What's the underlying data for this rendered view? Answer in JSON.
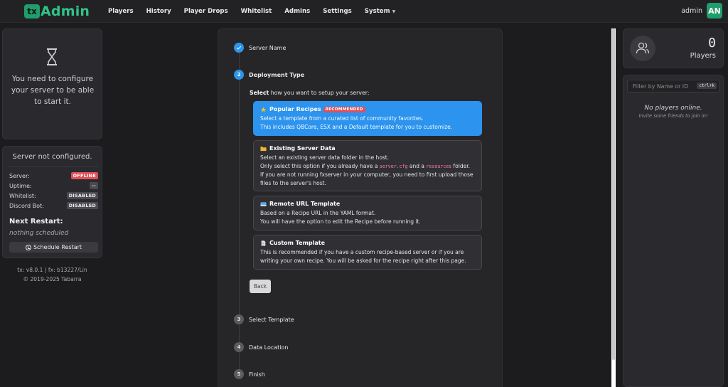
{
  "header": {
    "logo_mark": "tx",
    "logo_text": "Admin",
    "nav": [
      "Players",
      "History",
      "Player Drops",
      "Whitelist",
      "Admins",
      "Settings",
      "System"
    ],
    "username": "admin",
    "avatar_initials": "AN"
  },
  "notice": {
    "icon": "hourglass-icon",
    "text": "You need to configure your server to be able to start it."
  },
  "status": {
    "title": "Server not configured.",
    "rows": [
      {
        "label": "Server:",
        "value": "OFFLINE",
        "color": "#e0505a"
      },
      {
        "label": "Uptime:",
        "value": "--",
        "color": "#4a4a50"
      },
      {
        "label": "Whitelist:",
        "value": "DISABLED",
        "color": "#4a4a50"
      },
      {
        "label": "Discord Bot:",
        "value": "DISABLED",
        "color": "#4a4a50"
      }
    ],
    "next_restart_label": "Next Restart:",
    "next_restart_value": "nothing scheduled",
    "schedule_button": "Schedule Restart"
  },
  "version": {
    "line1": "tx: v8.0.1 | fx: b13227/Lin",
    "line2": "© 2019-2025 Tabarra"
  },
  "wizard": {
    "steps": [
      {
        "number": "1",
        "label": "Server Name",
        "state": "done"
      },
      {
        "number": "2",
        "label": "Deployment Type",
        "state": "active"
      },
      {
        "number": "3",
        "label": "Select Template",
        "state": "pending"
      },
      {
        "number": "4",
        "label": "Data Location",
        "state": "pending"
      },
      {
        "number": "5",
        "label": "Finish",
        "state": "pending"
      }
    ],
    "select_bold": "Select",
    "select_rest": " how you want to setup your server:",
    "options": [
      {
        "title": "Popular Recipes",
        "badge": "RECOMMENDED",
        "icon": "star-icon",
        "desc1": "Select a template from a curated list of community favorites.",
        "desc2": "This includes QBCore, ESX and a Default template for you to customize."
      },
      {
        "title": "Existing Server Data",
        "icon": "folder-icon",
        "desc1": "Select an existing server data folder in the host.",
        "desc2_a": "Only select this option if you already have a ",
        "code1": "server.cfg",
        "desc2_b": " and a ",
        "code2": "resources",
        "desc2_c": " folder.",
        "desc3": "If you are not running fxserver in your computer, you need to first upload those files to the server's host."
      },
      {
        "title": "Remote URL Template",
        "icon": "cloud-download-icon",
        "desc1": "Based on a Recipe URL in the YAML format.",
        "desc2": "You will have the option to edit the Recipe before running it."
      },
      {
        "title": "Custom Template",
        "icon": "document-icon",
        "desc1": "This is recommended if you have a custom recipe-based server or if you are writing your own recipe. You will be asked for the recipe right after this page."
      }
    ],
    "back_button": "Back"
  },
  "players": {
    "count": "0",
    "label": "Players",
    "filter_placeholder": "Filter by Name or ID",
    "shortcut": "ctrl+k",
    "empty_title": "No players online.",
    "empty_subtitle": "Invite some friends to join in!"
  }
}
